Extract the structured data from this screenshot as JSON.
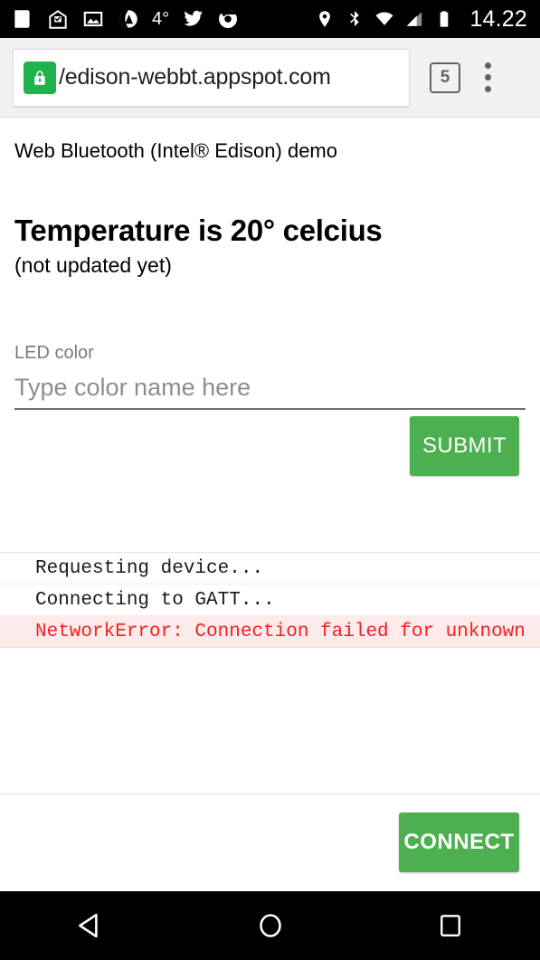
{
  "status_bar": {
    "left_icons": [
      {
        "name": "news-icon",
        "glyph": "news"
      },
      {
        "name": "inbox-mail-icon",
        "glyph": "inbox"
      },
      {
        "name": "photos-image-icon",
        "glyph": "photo"
      },
      {
        "name": "app-circle-icon",
        "glyph": "appcircle"
      }
    ],
    "temperature_indicator": "4°",
    "after_temp_icons": [
      {
        "name": "twitter-bird-icon",
        "glyph": "twitter"
      },
      {
        "name": "chrome-icon",
        "glyph": "chrome"
      }
    ],
    "right_icons": [
      {
        "name": "location-pin-icon",
        "glyph": "location"
      },
      {
        "name": "bluetooth-icon",
        "glyph": "bluetooth"
      },
      {
        "name": "wifi-icon",
        "glyph": "wifi"
      },
      {
        "name": "cell-signal-icon",
        "glyph": "signal"
      },
      {
        "name": "battery-icon",
        "glyph": "battery"
      }
    ],
    "clock": "14.22"
  },
  "browser": {
    "security_icon": "lock-icon",
    "url": "/edison-webbt.appspot.com",
    "tab_count": "5",
    "menu_icon": "overflow-menu-icon"
  },
  "page": {
    "demo_title": "Web Bluetooth (Intel® Edison) demo",
    "temperature_heading": "Temperature is 20° celcius",
    "temperature_sub": "(not updated yet)",
    "led": {
      "label": "LED color",
      "placeholder": "Type color name here",
      "value": ""
    },
    "submit_label": "SUBMIT",
    "connect_label": "CONNECT",
    "log": [
      {
        "text": "Requesting device...",
        "level": "info"
      },
      {
        "text": "Connecting to GATT...",
        "level": "info"
      },
      {
        "text": "NetworkError: Connection failed for unknown",
        "level": "error"
      }
    ]
  },
  "nav_bar": {
    "back": "back-triangle-icon",
    "home": "home-circle-icon",
    "recents": "recents-square-icon"
  },
  "colors": {
    "accent_green": "#4caf50",
    "lock_green": "#22b24c",
    "error_text": "#f22121",
    "error_bg": "#fdeaea",
    "toolbar_bg": "#f1f1f1",
    "system_bar": "#000000"
  }
}
